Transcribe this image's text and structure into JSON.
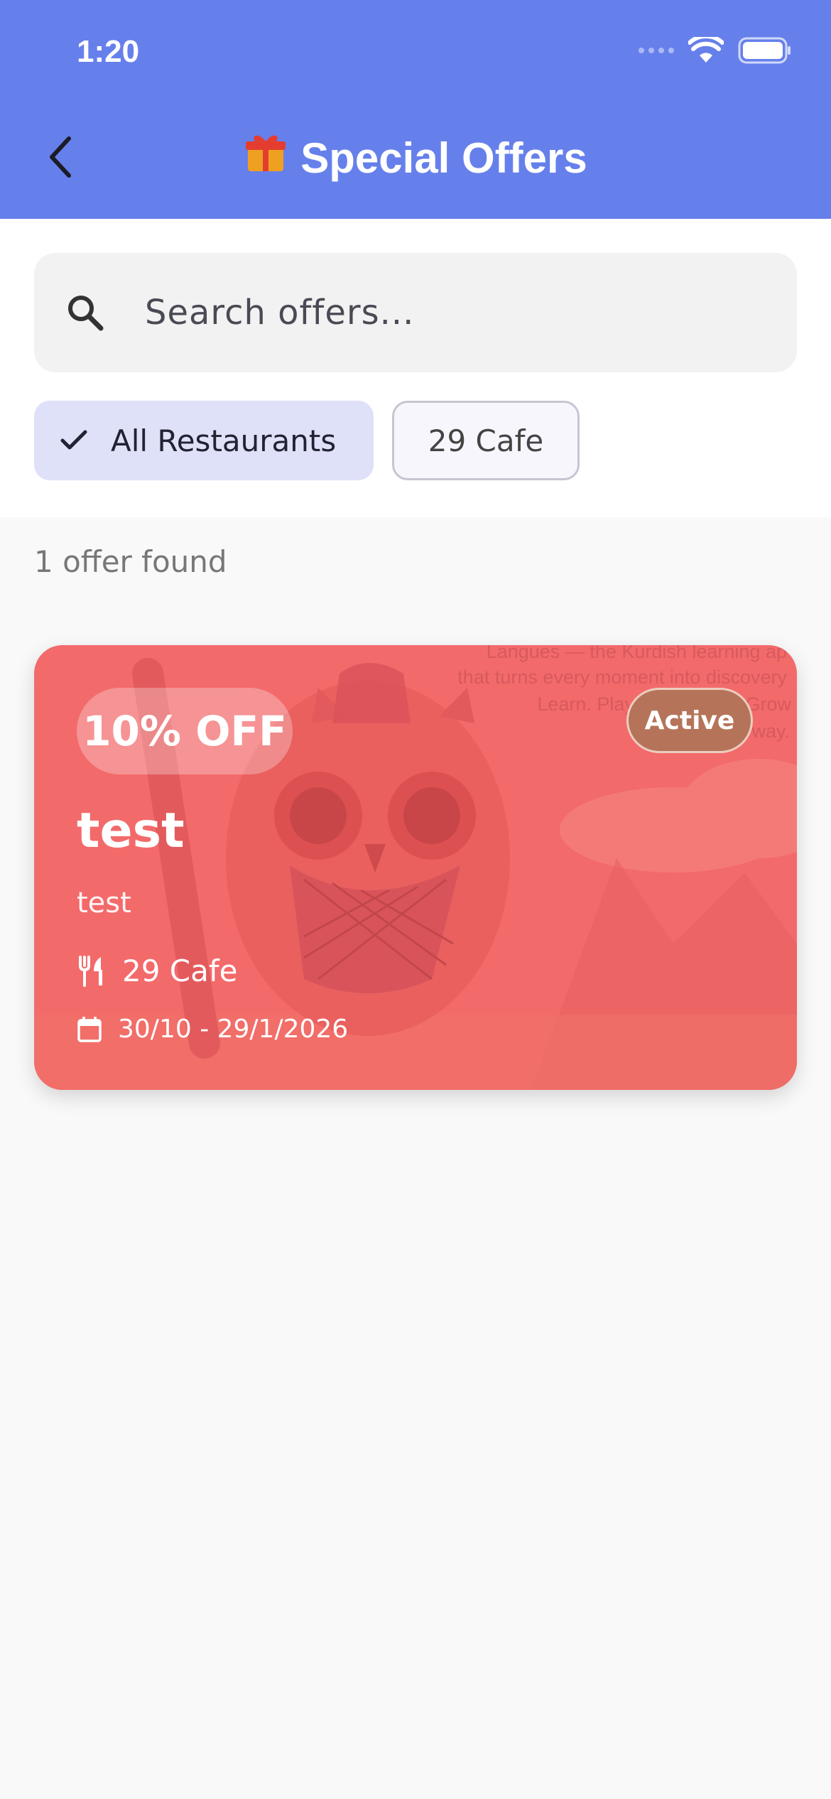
{
  "status_bar": {
    "time": "1:20"
  },
  "header": {
    "title": "Special Offers",
    "back_icon": "chevron-left-icon",
    "title_icon": "gift-icon"
  },
  "search": {
    "placeholder": "Search offers..."
  },
  "filters": {
    "chips": [
      {
        "label": "All Restaurants",
        "selected": true
      },
      {
        "label": "29 Cafe",
        "selected": false
      }
    ]
  },
  "results": {
    "count_text": "1 offer found"
  },
  "offers": [
    {
      "discount": "10% OFF",
      "status": "Active",
      "title": "test",
      "description": "test",
      "restaurant": "29 Cafe",
      "date_range": "30/10 - 29/1/2026",
      "card_color": "#f36a6b",
      "background_text": [
        "Langues — the Kurdish learning ap",
        "that turns every moment into discovery",
        "Learn. Play. Grow. Play. Grow",
        "way."
      ]
    }
  ],
  "colors": {
    "primary": "#6680eb",
    "chip_selected": "#dee1f7",
    "status_active": "#b57459"
  }
}
